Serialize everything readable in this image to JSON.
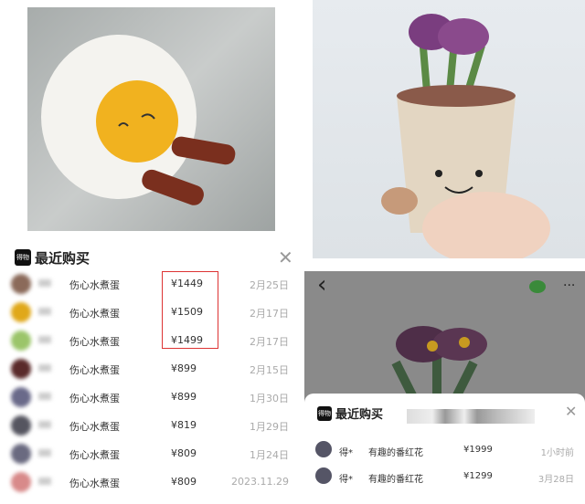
{
  "left_panel": {
    "logo": "得物",
    "title": "最近购买",
    "close": "✕",
    "rows": [
      {
        "product": "伤心水煮蛋",
        "price": "¥1449",
        "date": "2月25日",
        "color": "#8b6a5a"
      },
      {
        "product": "伤心水煮蛋",
        "price": "¥1509",
        "date": "2月17日",
        "color": "#e0a81a"
      },
      {
        "product": "伤心水煮蛋",
        "price": "¥1499",
        "date": "2月17日",
        "color": "#9bc56a"
      },
      {
        "product": "伤心水煮蛋",
        "price": "¥899",
        "date": "2月15日",
        "color": "#5a2a2a"
      },
      {
        "product": "伤心水煮蛋",
        "price": "¥899",
        "date": "1月30日",
        "color": "#6a6a8a"
      },
      {
        "product": "伤心水煮蛋",
        "price": "¥819",
        "date": "1月29日",
        "color": "#555560"
      },
      {
        "product": "伤心水煮蛋",
        "price": "¥809",
        "date": "1月24日",
        "color": "#6a6a80"
      },
      {
        "product": "伤心水煮蛋",
        "price": "¥809",
        "date": "2023.11.29",
        "color": "#d88a8a"
      }
    ],
    "highlight_color": "#dd3333"
  },
  "right_panel": {
    "back": "‹",
    "more": "···",
    "logo": "得物",
    "title": "最近购买",
    "close": "✕",
    "rows": [
      {
        "user": "得*",
        "product": "有趣的番红花",
        "price": "¥1999",
        "date": "1小时前"
      },
      {
        "user": "得*",
        "product": "有趣的番红花",
        "price": "¥1299",
        "date": "3月28日"
      }
    ]
  }
}
